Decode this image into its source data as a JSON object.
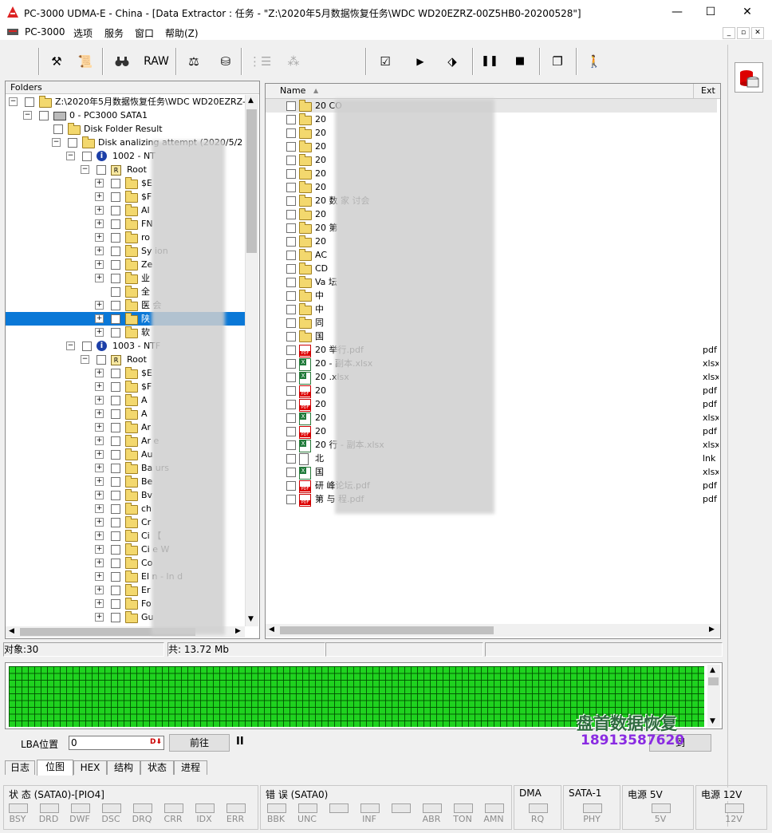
{
  "window": {
    "title": "PC-3000 UDMA-E - China - [Data Extractor : 任务 - \"Z:\\2020年5月数据恢复任务\\WDC WD20EZRZ-00Z5HB0-20200528\"]",
    "minimize": "—",
    "maximize": "☐",
    "close": "✕"
  },
  "menu": [
    "PC-3000",
    "选项",
    "服务",
    "窗口",
    "帮助(Z)"
  ],
  "mdi": [
    "_",
    "▫",
    "✕"
  ],
  "toolbar": {
    "raw_label": "RAW"
  },
  "folders": {
    "header": "Folders",
    "rows": [
      {
        "indent": 0,
        "exp": "−",
        "icon": "drive-folder",
        "label": "Z:\\2020年5月数据恢复任务\\WDC WD20EZRZ-"
      },
      {
        "indent": 1,
        "exp": "−",
        "icon": "disk",
        "label": "0 - PC3000 SATA1"
      },
      {
        "indent": 2,
        "exp": "",
        "icon": "folder",
        "label": "Disk Folder Result"
      },
      {
        "indent": 3,
        "exp": "−",
        "icon": "folder",
        "label": "Disk analizing attempt            (2020/5/2"
      },
      {
        "indent": 4,
        "exp": "−",
        "icon": "info",
        "label": "1002 - NT"
      },
      {
        "indent": 5,
        "exp": "−",
        "icon": "root",
        "label": "Root"
      },
      {
        "indent": 6,
        "exp": "+",
        "icon": "folder",
        "label": "$E"
      },
      {
        "indent": 6,
        "exp": "+",
        "icon": "folder",
        "label": "$F"
      },
      {
        "indent": 6,
        "exp": "+",
        "icon": "folder",
        "label": "Al"
      },
      {
        "indent": 6,
        "exp": "+",
        "icon": "folder",
        "label": "FN"
      },
      {
        "indent": 6,
        "exp": "+",
        "icon": "folder",
        "label": "ro"
      },
      {
        "indent": 6,
        "exp": "+",
        "icon": "folder",
        "label": "Sy                          ion"
      },
      {
        "indent": 6,
        "exp": "+",
        "icon": "folder",
        "label": "Ze"
      },
      {
        "indent": 6,
        "exp": "+",
        "icon": "folder",
        "label": "业"
      },
      {
        "indent": 6,
        "exp": "",
        "icon": "folder",
        "label": "全"
      },
      {
        "indent": 6,
        "exp": "+",
        "icon": "folder",
        "label": "医                          会"
      },
      {
        "indent": 6,
        "exp": "+",
        "icon": "folder",
        "label": "陕",
        "selected": true
      },
      {
        "indent": 6,
        "exp": "+",
        "icon": "folder",
        "label": "软"
      },
      {
        "indent": 4,
        "exp": "−",
        "icon": "info",
        "label": "1003 - NTF"
      },
      {
        "indent": 5,
        "exp": "−",
        "icon": "root",
        "label": "Root"
      },
      {
        "indent": 6,
        "exp": "+",
        "icon": "folder",
        "label": "$E"
      },
      {
        "indent": 6,
        "exp": "+",
        "icon": "folder",
        "label": "$F"
      },
      {
        "indent": 6,
        "exp": "+",
        "icon": "folder",
        "label": "A"
      },
      {
        "indent": 6,
        "exp": "+",
        "icon": "folder",
        "label": "A"
      },
      {
        "indent": 6,
        "exp": "+",
        "icon": "folder",
        "label": "Ar"
      },
      {
        "indent": 6,
        "exp": "+",
        "icon": "folder",
        "label": "Ar                          e"
      },
      {
        "indent": 6,
        "exp": "+",
        "icon": "folder",
        "label": "Au"
      },
      {
        "indent": 6,
        "exp": "+",
        "icon": "folder",
        "label": "Ba                          urs"
      },
      {
        "indent": 6,
        "exp": "+",
        "icon": "folder",
        "label": "Be"
      },
      {
        "indent": 6,
        "exp": "+",
        "icon": "folder",
        "label": "Bv"
      },
      {
        "indent": 6,
        "exp": "+",
        "icon": "folder",
        "label": "ch"
      },
      {
        "indent": 6,
        "exp": "+",
        "icon": "folder",
        "label": "Cr"
      },
      {
        "indent": 6,
        "exp": "+",
        "icon": "folder",
        "label": "Ci                          【"
      },
      {
        "indent": 6,
        "exp": "+",
        "icon": "folder",
        "label": "Ci                          e W"
      },
      {
        "indent": 6,
        "exp": "+",
        "icon": "folder",
        "label": "Co"
      },
      {
        "indent": 6,
        "exp": "+",
        "icon": "folder",
        "label": "El              n - In      d"
      },
      {
        "indent": 6,
        "exp": "+",
        "icon": "folder",
        "label": "Er"
      },
      {
        "indent": 6,
        "exp": "+",
        "icon": "folder",
        "label": "Fo"
      },
      {
        "indent": 6,
        "exp": "+",
        "icon": "folder",
        "label": "Gu"
      }
    ]
  },
  "files": {
    "col_name": "Name",
    "col_ext": "Ext",
    "rows": [
      {
        "icon": "folder",
        "name": "20        CO",
        "ext": ""
      },
      {
        "icon": "folder",
        "name": "20",
        "ext": ""
      },
      {
        "icon": "folder",
        "name": "20",
        "ext": ""
      },
      {
        "icon": "folder",
        "name": "20",
        "ext": ""
      },
      {
        "icon": "folder",
        "name": "20",
        "ext": ""
      },
      {
        "icon": "folder",
        "name": "20",
        "ext": ""
      },
      {
        "icon": "folder",
        "name": "20",
        "ext": ""
      },
      {
        "icon": "folder",
        "name": "20                    数              家                    讨会",
        "ext": ""
      },
      {
        "icon": "folder",
        "name": "20",
        "ext": ""
      },
      {
        "icon": "folder",
        "name": "20                                        第",
        "ext": ""
      },
      {
        "icon": "folder",
        "name": "20",
        "ext": ""
      },
      {
        "icon": "folder",
        "name": "AC",
        "ext": ""
      },
      {
        "icon": "folder",
        "name": "CD",
        "ext": ""
      },
      {
        "icon": "folder",
        "name": "Va                                   坛",
        "ext": ""
      },
      {
        "icon": "folder",
        "name": "中",
        "ext": ""
      },
      {
        "icon": "folder",
        "name": "中",
        "ext": ""
      },
      {
        "icon": "folder",
        "name": "同",
        "ext": ""
      },
      {
        "icon": "folder",
        "name": "国",
        "ext": ""
      },
      {
        "icon": "pdf",
        "name": "20                                              举行.pdf",
        "ext": "pdf"
      },
      {
        "icon": "xls",
        "name": "20                                        - 副本.xlsx",
        "ext": "xlsx"
      },
      {
        "icon": "xls",
        "name": "20                                        .xlsx",
        "ext": "xlsx"
      },
      {
        "icon": "pdf",
        "name": "20",
        "ext": "pdf"
      },
      {
        "icon": "pdf",
        "name": "20",
        "ext": "pdf"
      },
      {
        "icon": "xls",
        "name": "20",
        "ext": "xlsx"
      },
      {
        "icon": "pdf",
        "name": "20",
        "ext": "pdf"
      },
      {
        "icon": "xls",
        "name": "20                                        行 - 副本.xlsx",
        "ext": "xlsx"
      },
      {
        "icon": "lnk",
        "name": "北",
        "ext": "lnk"
      },
      {
        "icon": "xls",
        "name": "国",
        "ext": "xlsx"
      },
      {
        "icon": "pdf",
        "name": "研                                        峰论坛.pdf",
        "ext": "pdf"
      },
      {
        "icon": "pdf",
        "name": "第               与                       程.pdf",
        "ext": "pdf"
      }
    ]
  },
  "status": {
    "objects": "对象:30",
    "total": "共: 13.72 Mb"
  },
  "lba": {
    "label": "LBA位置",
    "value": "0",
    "go_button": "前往",
    "pause": "II",
    "right_button": "到"
  },
  "tabs": [
    "日志",
    "位图",
    "HEX",
    "结构",
    "状态",
    "进程"
  ],
  "active_tab": 1,
  "indicators": {
    "status_title": "状 态 (SATA0)-[PIO4]",
    "status_leds": [
      "BSY",
      "DRD",
      "DWF",
      "DSC",
      "DRQ",
      "CRR",
      "IDX",
      "ERR"
    ],
    "error_title": "错 误 (SATA0)",
    "error_leds": [
      "BBK",
      "UNC",
      "",
      "INF",
      "",
      "ABR",
      "TON",
      "AMN"
    ],
    "dma_title": "DMA",
    "dma_leds": [
      "RQ"
    ],
    "sata_title": "SATA-1",
    "sata_leds": [
      "PHY"
    ],
    "p5_title": "电源 5V",
    "p5_leds": [
      "5V"
    ],
    "p12_title": "电源 12V",
    "p12_leds": [
      "12V"
    ]
  },
  "watermark": {
    "line1": "盘首数据恢复",
    "line2": "18913587620"
  }
}
